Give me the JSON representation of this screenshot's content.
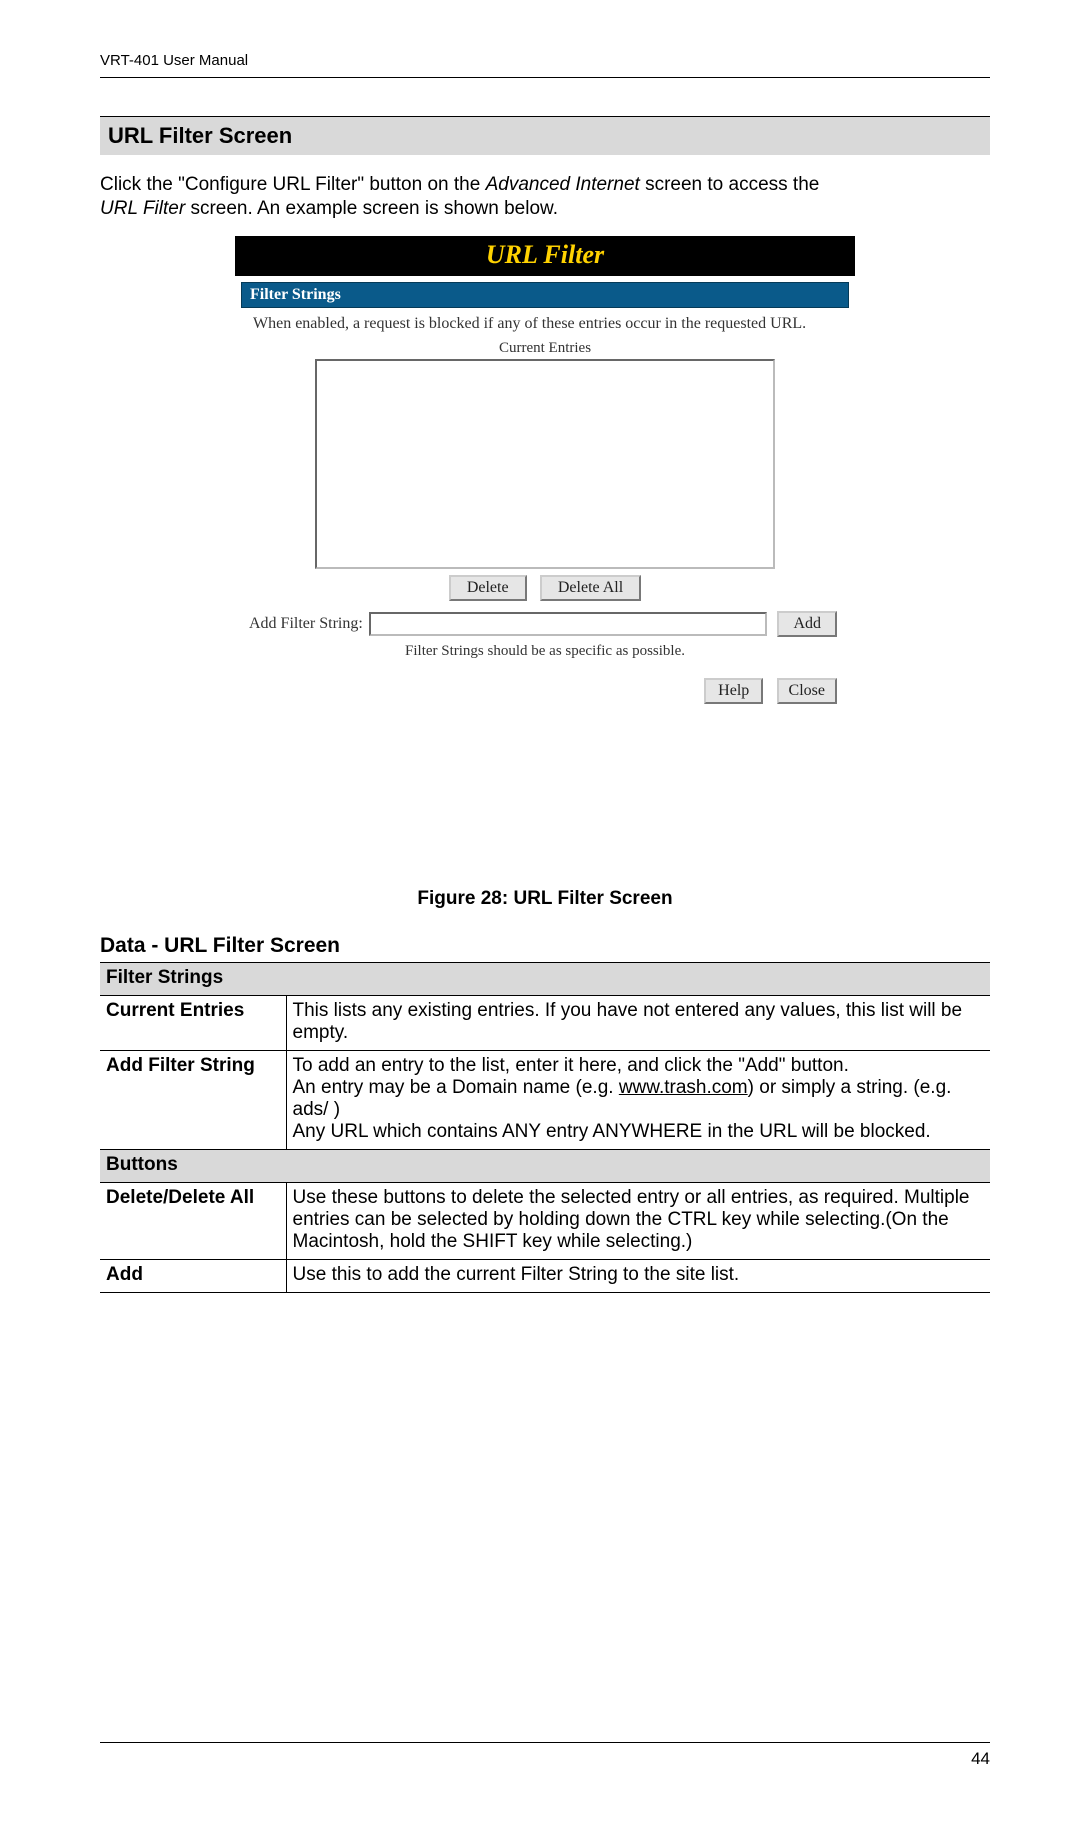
{
  "header": {
    "docid": "VRT-401 User Manual"
  },
  "section": {
    "title": "URL Filter Screen"
  },
  "intro": {
    "line1_a": "Click the \"Configure URL Filter\" button on the ",
    "line1_b": "Advanced Internet",
    "line1_c": " screen to access the ",
    "line2_a": "URL Filter",
    "line2_b": " screen. An example screen is shown below."
  },
  "mock": {
    "title": "URL Filter",
    "section_header": "Filter Strings",
    "desc": "When enabled, a request is blocked if any of these entries occur in the requested URL.",
    "current_entries_label": "Current Entries",
    "delete_label": "Delete",
    "delete_all_label": "Delete All",
    "add_filter_label": "Add Filter String:",
    "add_label": "Add",
    "hint": "Filter Strings should be as specific as possible.",
    "help_label": "Help",
    "close_label": "Close"
  },
  "figure": {
    "caption": "Figure 28: URL Filter Screen"
  },
  "data_section": {
    "title": "Data - URL Filter Screen"
  },
  "table": {
    "group1": "Filter Strings",
    "row1_label": "Current Entries",
    "row1_body": "This lists any existing entries. If you have not entered any values, this list will be empty.",
    "row2_label": "Add Filter String",
    "row2_body_a": "To add an entry to the list, enter it here, and click the \"Add\" button.",
    "row2_body_b1": "An entry may be a Domain name (e.g. ",
    "row2_body_link": "www.trash.com",
    "row2_body_b2": ") or simply a string. (e.g. ads/ )",
    "row2_body_c": "Any URL which contains ANY entry ANYWHERE in the URL will be blocked.",
    "group2": "Buttons",
    "row3_label": "Delete/Delete All",
    "row3_body": "Use these buttons to delete the selected entry or all entries, as required. Multiple entries can be selected by holding down the CTRL key while selecting.(On the Macintosh, hold the SHIFT key while selecting.)",
    "row4_label": "Add",
    "row4_body": "Use this to add the current Filter String to the site list."
  },
  "footer": {
    "pagenum": "44"
  }
}
